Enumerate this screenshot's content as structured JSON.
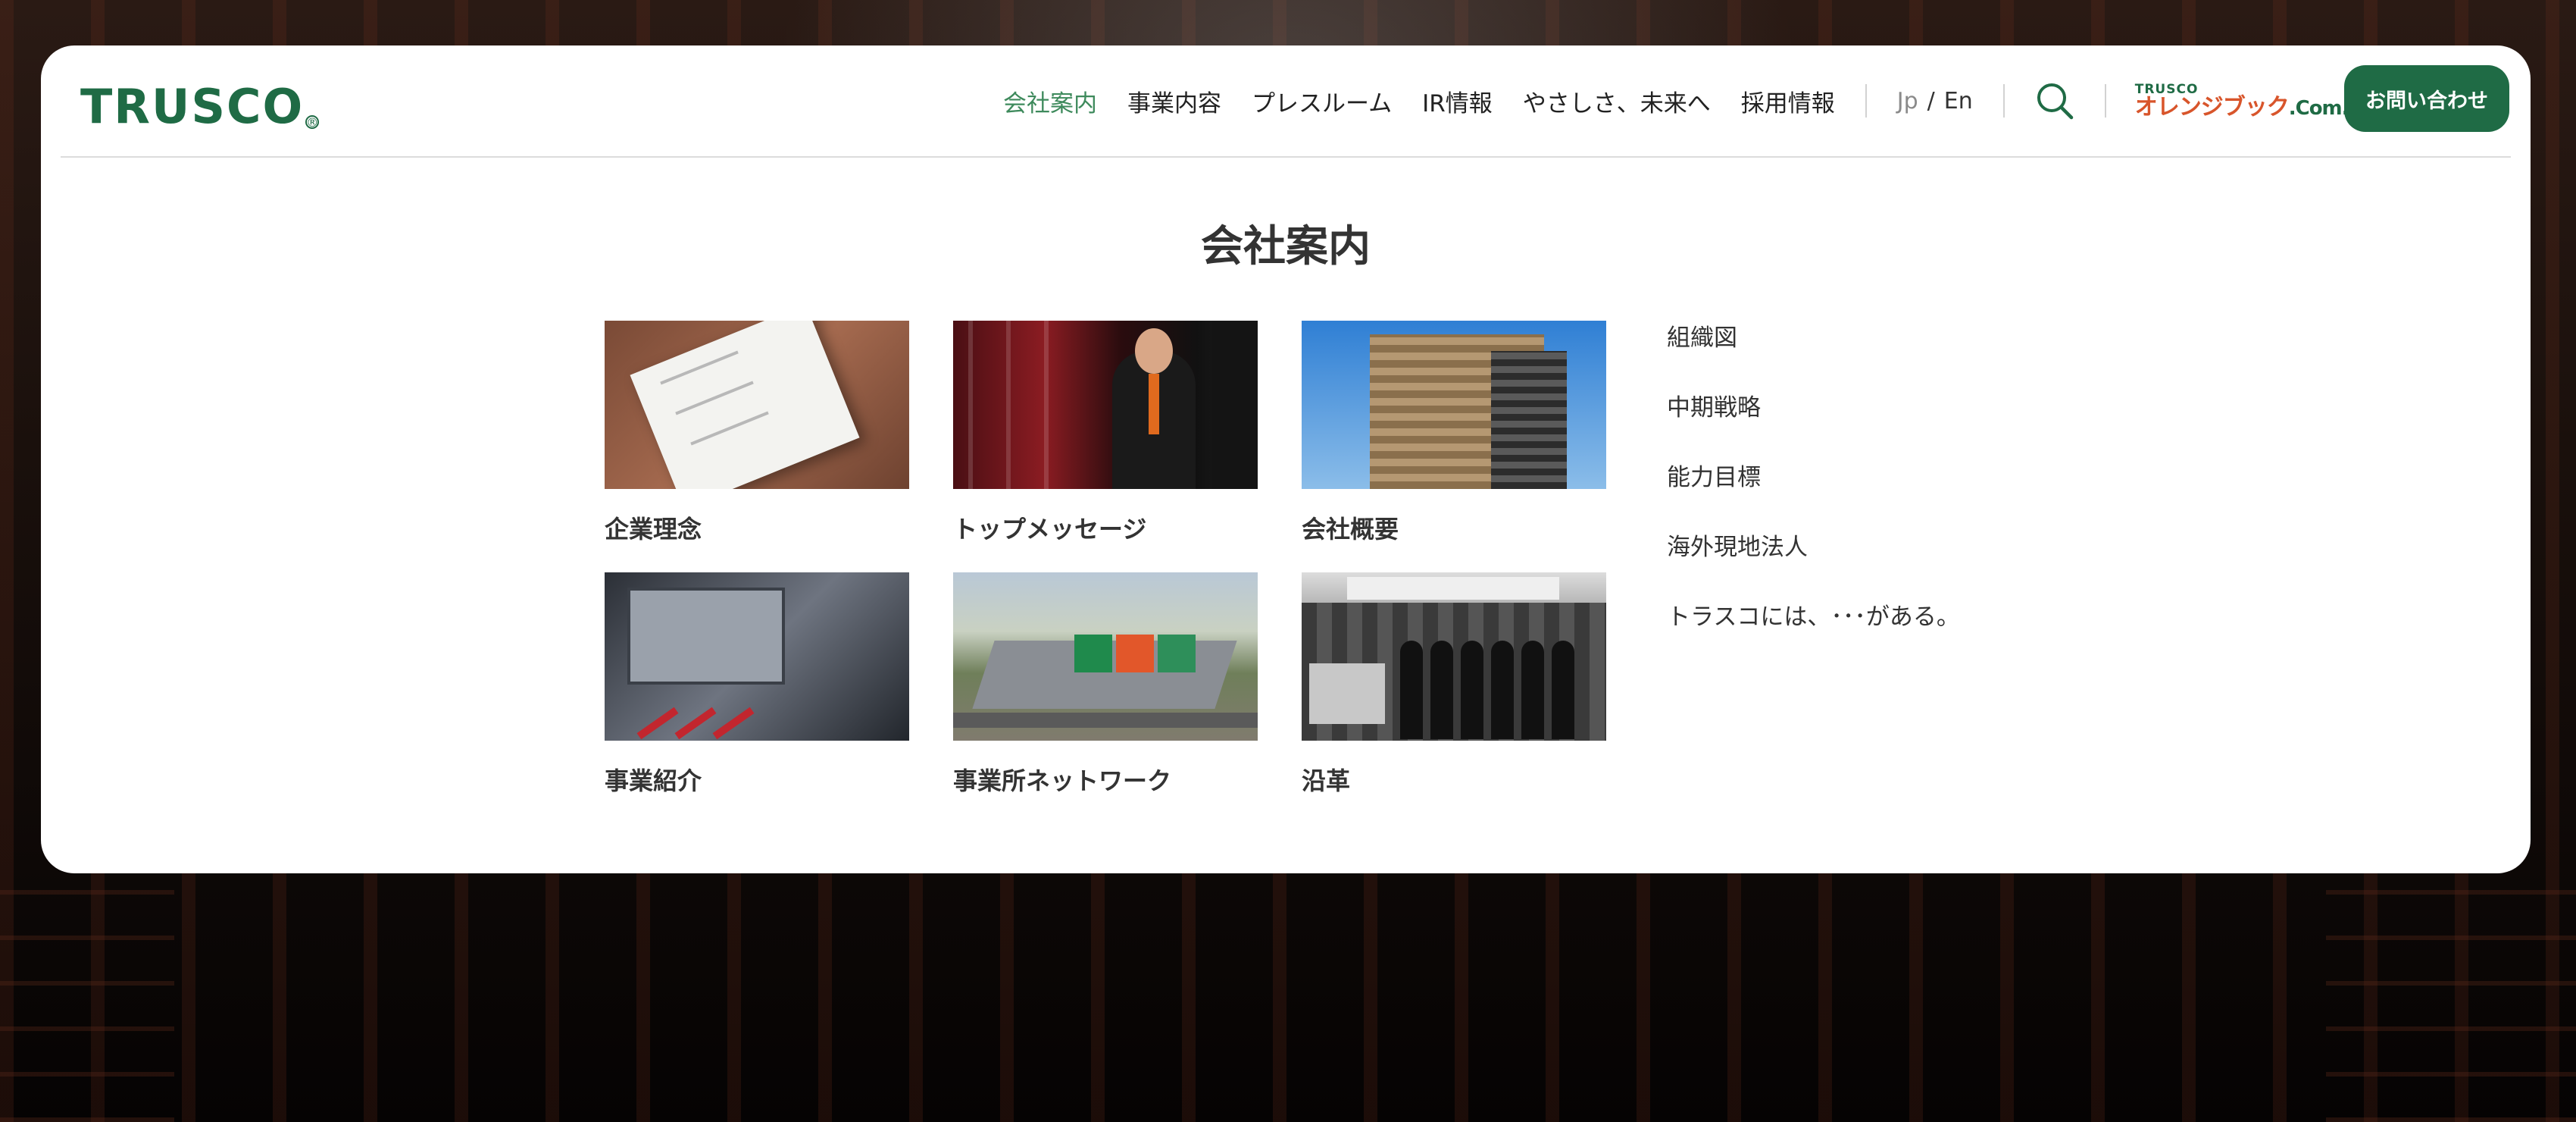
{
  "brand": {
    "logo": "TRUSCO",
    "registered": "®"
  },
  "nav": {
    "items": [
      "会社案内",
      "事業内容",
      "プレスルーム",
      "IR情報",
      "やさしさ、未来へ",
      "採用情報"
    ],
    "active_index": 0,
    "lang_jp": "Jp",
    "lang_sep": "/",
    "lang_en": "En",
    "search_icon": "search-icon",
    "orangebook_small": "TRUSCO",
    "orangebook_main": "オレンジブック",
    "orangebook_suffix": ".Com.",
    "contact_label": "お問い合わせ"
  },
  "colors": {
    "brand_green": "#1f6b45",
    "active_green": "#3e8a5c",
    "orange": "#d8552b"
  },
  "menu": {
    "title": "会社案内",
    "cards": [
      {
        "label": "企業理念",
        "image": "corporate-philosophy-photo"
      },
      {
        "label": "トップメッセージ",
        "image": "top-message-photo"
      },
      {
        "label": "会社概要",
        "image": "company-building-photo"
      },
      {
        "label": "事業紹介",
        "image": "tools-photo"
      },
      {
        "label": "事業所ネットワーク",
        "image": "logistics-center-photo"
      },
      {
        "label": "沿革",
        "image": "history-photo"
      }
    ],
    "links": [
      "組織図",
      "中期戦略",
      "能力目標",
      "海外現地法人",
      "トラスコには、･･･がある。"
    ]
  }
}
